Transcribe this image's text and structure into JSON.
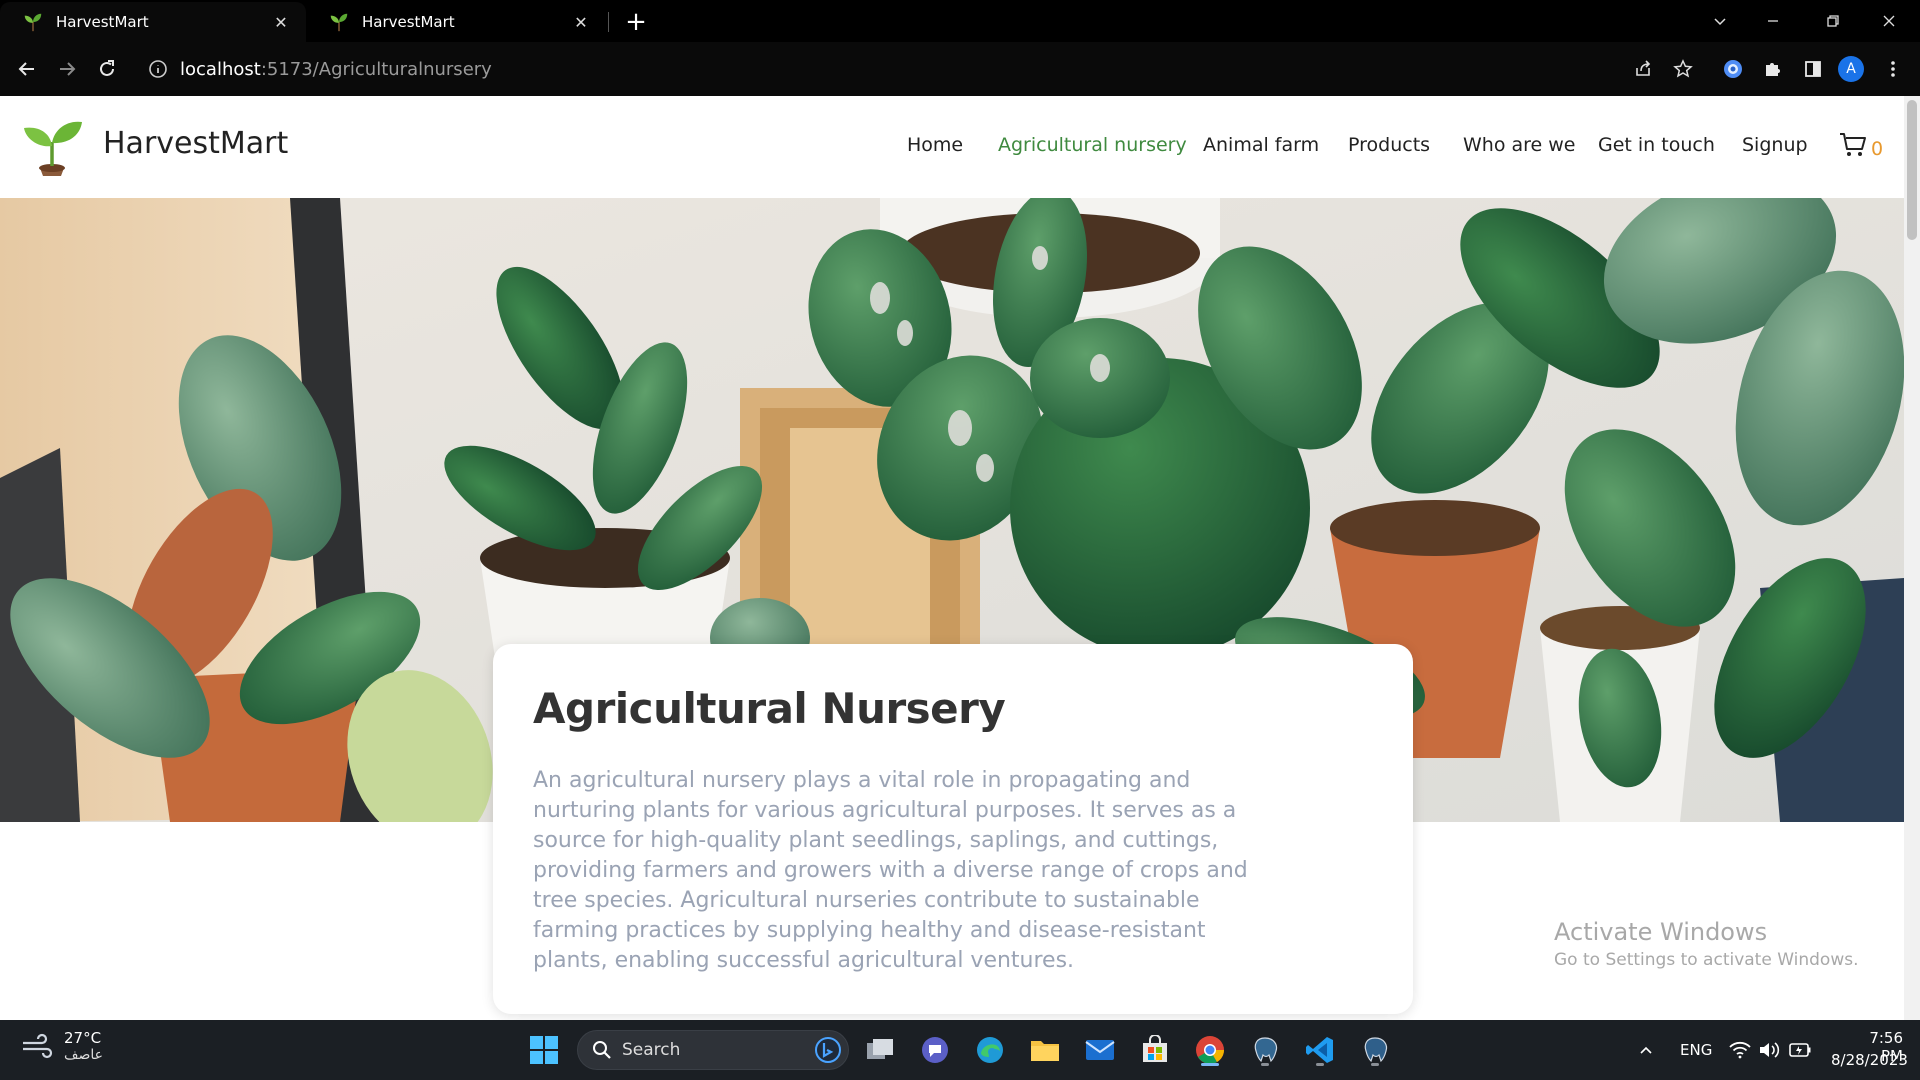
{
  "browser": {
    "tabs": [
      {
        "title": "HarvestMart",
        "active": true
      },
      {
        "title": "HarvestMart",
        "active": false
      }
    ],
    "url_host": "localhost",
    "url_path": ":5173/Agriculturalnursery",
    "profile_initial": "A"
  },
  "site": {
    "brand": "HarvestMart",
    "nav": [
      {
        "label": "Home",
        "active": false
      },
      {
        "label": "Agricultural nursery",
        "active": true
      },
      {
        "label": "Animal farm",
        "active": false
      },
      {
        "label": "Products",
        "active": false
      },
      {
        "label": "Who are we",
        "active": false
      },
      {
        "label": "Get in touch",
        "active": false
      },
      {
        "label": "Signup",
        "active": false
      }
    ],
    "cart_count": "0",
    "accent_color": "#3f8a3f",
    "cart_count_color": "#e8992e"
  },
  "hero_card": {
    "title": "Agricultural Nursery",
    "body": "An agricultural nursery plays a vital role in propagating and nurturing plants for various agricultural purposes. It serves as a source for high-quality plant seedlings, saplings, and cuttings, providing farmers and growers with a diverse range of crops and tree species. Agricultural nurseries contribute to sustainable farming practices by supplying healthy and disease-resistant plants, enabling successful agricultural ventures."
  },
  "watermark": {
    "line1": "Activate Windows",
    "line2": "Go to Settings to activate Windows."
  },
  "taskbar": {
    "weather_temp": "27°C",
    "weather_cond": "عاصف",
    "search_label": "Search",
    "lang": "ENG",
    "time": "7:56 PM",
    "date": "8/28/2023"
  }
}
